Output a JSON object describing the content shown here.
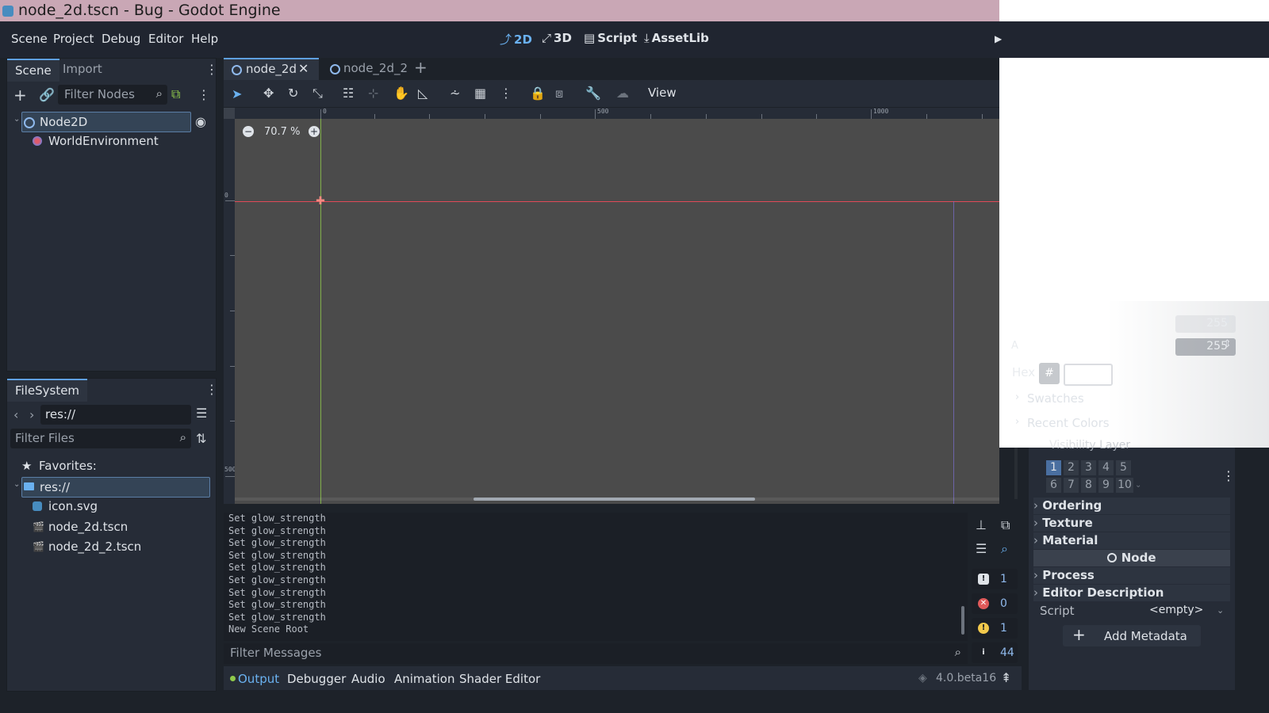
{
  "window": {
    "title": "node_2d.tscn - Bug - Godot Engine"
  },
  "menu": [
    "Scene",
    "Project",
    "Debug",
    "Editor",
    "Help"
  ],
  "modes": [
    {
      "icon": "2d-mode-icon",
      "label": "2D",
      "active": true
    },
    {
      "icon": "3d-mode-icon",
      "label": "3D",
      "active": false
    },
    {
      "icon": "script-mode-icon",
      "label": "Script",
      "active": false
    },
    {
      "icon": "assetlib-icon",
      "label": "AssetLib",
      "active": false
    }
  ],
  "scene_dock": {
    "tabs": [
      "Scene",
      "Import"
    ],
    "filter_placeholder": "Filter Nodes",
    "tree": [
      {
        "label": "Node2D",
        "icon": "node2d-icon",
        "selected": true
      },
      {
        "label": "WorldEnvironment",
        "icon": "world-environment-icon",
        "selected": false
      }
    ]
  },
  "filesystem_dock": {
    "tab": "FileSystem",
    "path": "res://",
    "filter_placeholder": "Filter Files",
    "favorites_label": "Favorites:",
    "items": [
      {
        "label": "res://",
        "icon": "folder-icon",
        "selected": true
      },
      {
        "label": "icon.svg",
        "icon": "svg-file-icon"
      },
      {
        "label": "node_2d.tscn",
        "icon": "scene-file-icon"
      },
      {
        "label": "node_2d_2.tscn",
        "icon": "scene-file-icon"
      }
    ]
  },
  "viewport": {
    "tabs": [
      {
        "label": "node_2d",
        "active": true
      },
      {
        "label": "node_2d_2",
        "active": false
      }
    ],
    "view_label": "View",
    "zoom": "70.7 %",
    "ruler_top": [
      "0",
      "500",
      "1000"
    ],
    "ruler_left": [
      "0",
      "500"
    ]
  },
  "output": {
    "lines": [
      "Set glow_strength",
      "Set glow_strength",
      "Set glow_strength",
      "Set glow_strength",
      "Set glow_strength",
      "Set glow_strength",
      "Set glow_strength",
      "Set glow_strength",
      "Set glow_strength",
      "New Scene Root"
    ],
    "filter_placeholder": "Filter Messages",
    "counters": {
      "messages": "1",
      "errors": "0",
      "warnings": "1",
      "info": "44"
    }
  },
  "bottom_tabs": [
    "Output",
    "Debugger",
    "Audio",
    "Animation",
    "Shader Editor"
  ],
  "version": "4.0.beta16",
  "color_picker": {
    "b_value": "255",
    "a_label": "A",
    "a_value": "255",
    "hex_label": "Hex",
    "hash": "#",
    "swatches_label": "Swatches",
    "recent_label": "Recent Colors"
  },
  "inspector": {
    "visibility_layer_label": "Visibility Layer",
    "layers_row1": [
      "1",
      "2",
      "3",
      "4",
      "5"
    ],
    "layers_row2": [
      "6",
      "7",
      "8",
      "9",
      "10"
    ],
    "sections": [
      "Ordering",
      "Texture",
      "Material"
    ],
    "node_header": "Node",
    "sections2": [
      "Process",
      "Editor Description"
    ],
    "script_label": "Script",
    "script_value": "<empty>",
    "add_metadata": "Add Metadata"
  },
  "colors": {
    "accent": "#6ab1f0",
    "title_bar": "#c9a7b5",
    "canvas": "#4b4b4b",
    "x_axis": "#e04a58",
    "y_axis": "#8fc94b"
  }
}
